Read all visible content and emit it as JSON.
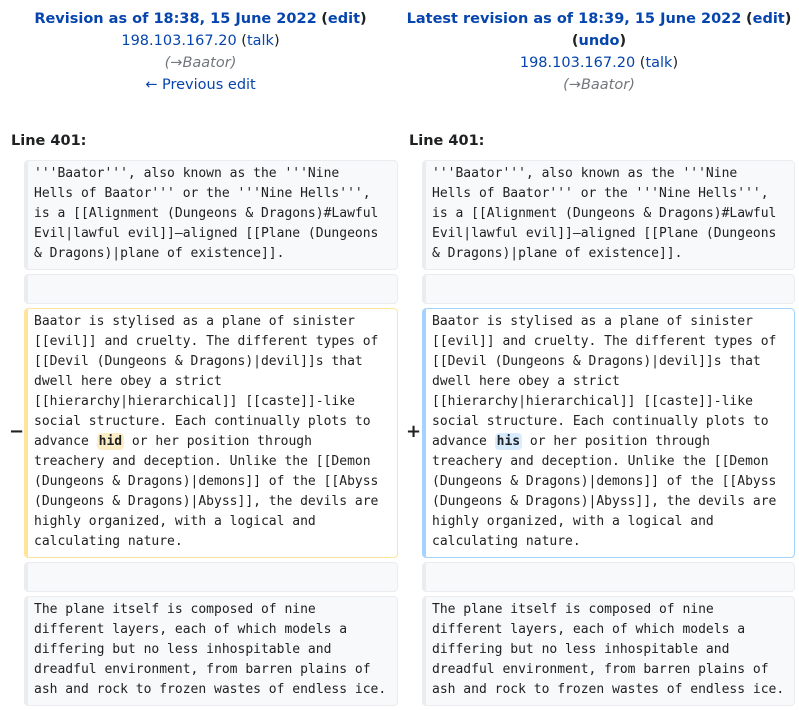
{
  "left_header": {
    "title": "Revision as of 18:38, 15 June 2022",
    "edit": "edit",
    "user": "198.103.167.20",
    "talk": "talk",
    "summary_section": "Baator",
    "prev_link": "← Previous edit"
  },
  "right_header": {
    "title": "Latest revision as of 18:39, 15 June 2022",
    "edit": "edit",
    "undo": "undo",
    "user": "198.103.167.20",
    "talk": "talk",
    "summary_section": "Baator"
  },
  "left_line": "Line 401:",
  "right_line": "Line 401:",
  "markers": {
    "minus": "−",
    "plus": "+"
  },
  "context1": "'''Baator''', also known as the '''Nine\nHells of Baator''' or the '''Nine Hells''',\nis a [[Alignment (Dungeons & Dragons)#Lawful\nEvil|lawful evil]]–aligned [[Plane (Dungeons\n& Dragons)|plane of existence]].",
  "changed_before": "Baator is stylised as a plane of sinister\n[[evil]] and cruelty. The different types of\n[[Devil (Dungeons & Dragons)|devil]]s that\ndwell here obey a strict\n[[hierarchy|hierarchical]] [[caste]]-like\nsocial structure. Each continually plots to\nadvance ",
  "removed_word": "hid",
  "added_word": "his",
  "changed_after": " or her position through\ntreachery and deception. Unlike the [[Demon\n(Dungeons & Dragons)|demons]] of the [[Abyss\n(Dungeons & Dragons)|Abyss]], the devils are\nhighly organized, with a logical and\ncalculating nature.",
  "context2": "The plane itself is composed of nine\ndifferent layers, each of which models a\ndiffering but no less inhospitable and\ndreadful environment, from barren plains of\nash and rock to frozen wastes of endless ice."
}
